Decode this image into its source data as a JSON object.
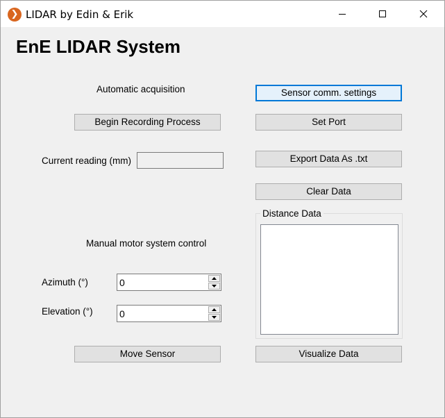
{
  "window": {
    "title": "LIDAR by Edin & Erik",
    "app_icon_glyph": "❯"
  },
  "heading": "EnE LIDAR System",
  "left": {
    "auto_acq_label": "Automatic acquisition",
    "begin_button": "Begin Recording Process",
    "current_reading_label": "Current reading (mm)",
    "current_reading_value": "",
    "manual_label": "Manual motor system control",
    "azimuth_label": "Azimuth (°)",
    "azimuth_value": "0",
    "elevation_label": "Elevation (°)",
    "elevation_value": "0",
    "move_button": "Move Sensor"
  },
  "right": {
    "sensor_settings_button": "Sensor comm. settings",
    "set_port_button": "Set Port",
    "export_button": "Export Data As .txt",
    "clear_button": "Clear Data",
    "distance_group_title": "Distance Data",
    "visualize_button": "Visualize Data"
  },
  "colors": {
    "focus_border": "#0078d7",
    "button_face": "#e1e1e1",
    "app_icon": "#d9661f"
  },
  "icons": {
    "minimize": "minimize-icon",
    "maximize": "maximize-icon",
    "close": "close-icon"
  }
}
